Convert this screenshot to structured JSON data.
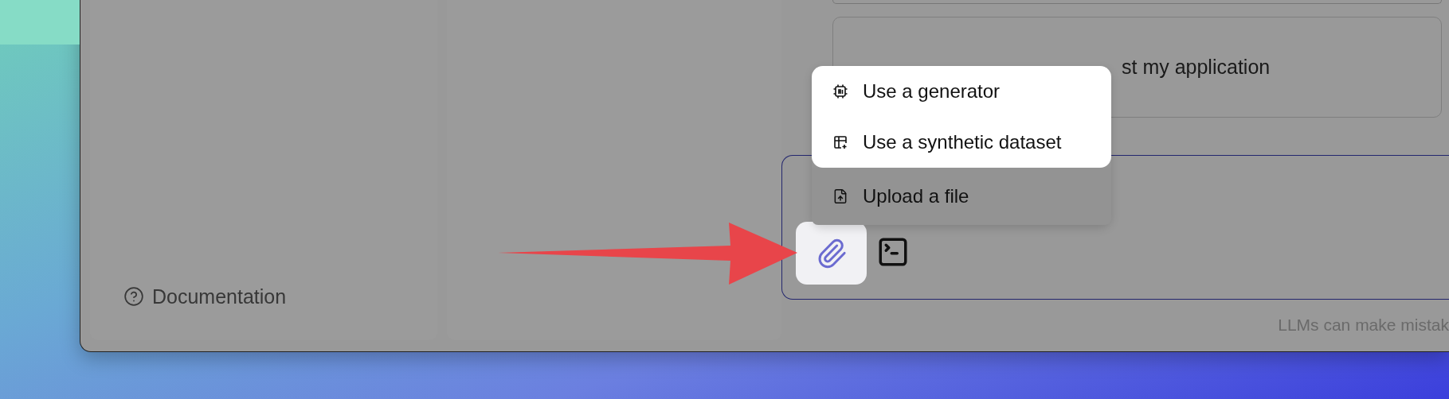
{
  "sidebar": {
    "footer_link": "Documentation"
  },
  "suggestion_card": {
    "text": "st my application"
  },
  "attach_menu": {
    "items": [
      {
        "kind": "generator",
        "label": "Use a generator",
        "highlighted": true
      },
      {
        "kind": "dataset",
        "label": "Use a synthetic dataset",
        "highlighted": true
      },
      {
        "kind": "upload",
        "label": "Upload a file",
        "highlighted": false
      }
    ]
  },
  "composer": {
    "attach_button": {
      "highlighted": true
    }
  },
  "disclaimer": "LLMs can make mistak"
}
